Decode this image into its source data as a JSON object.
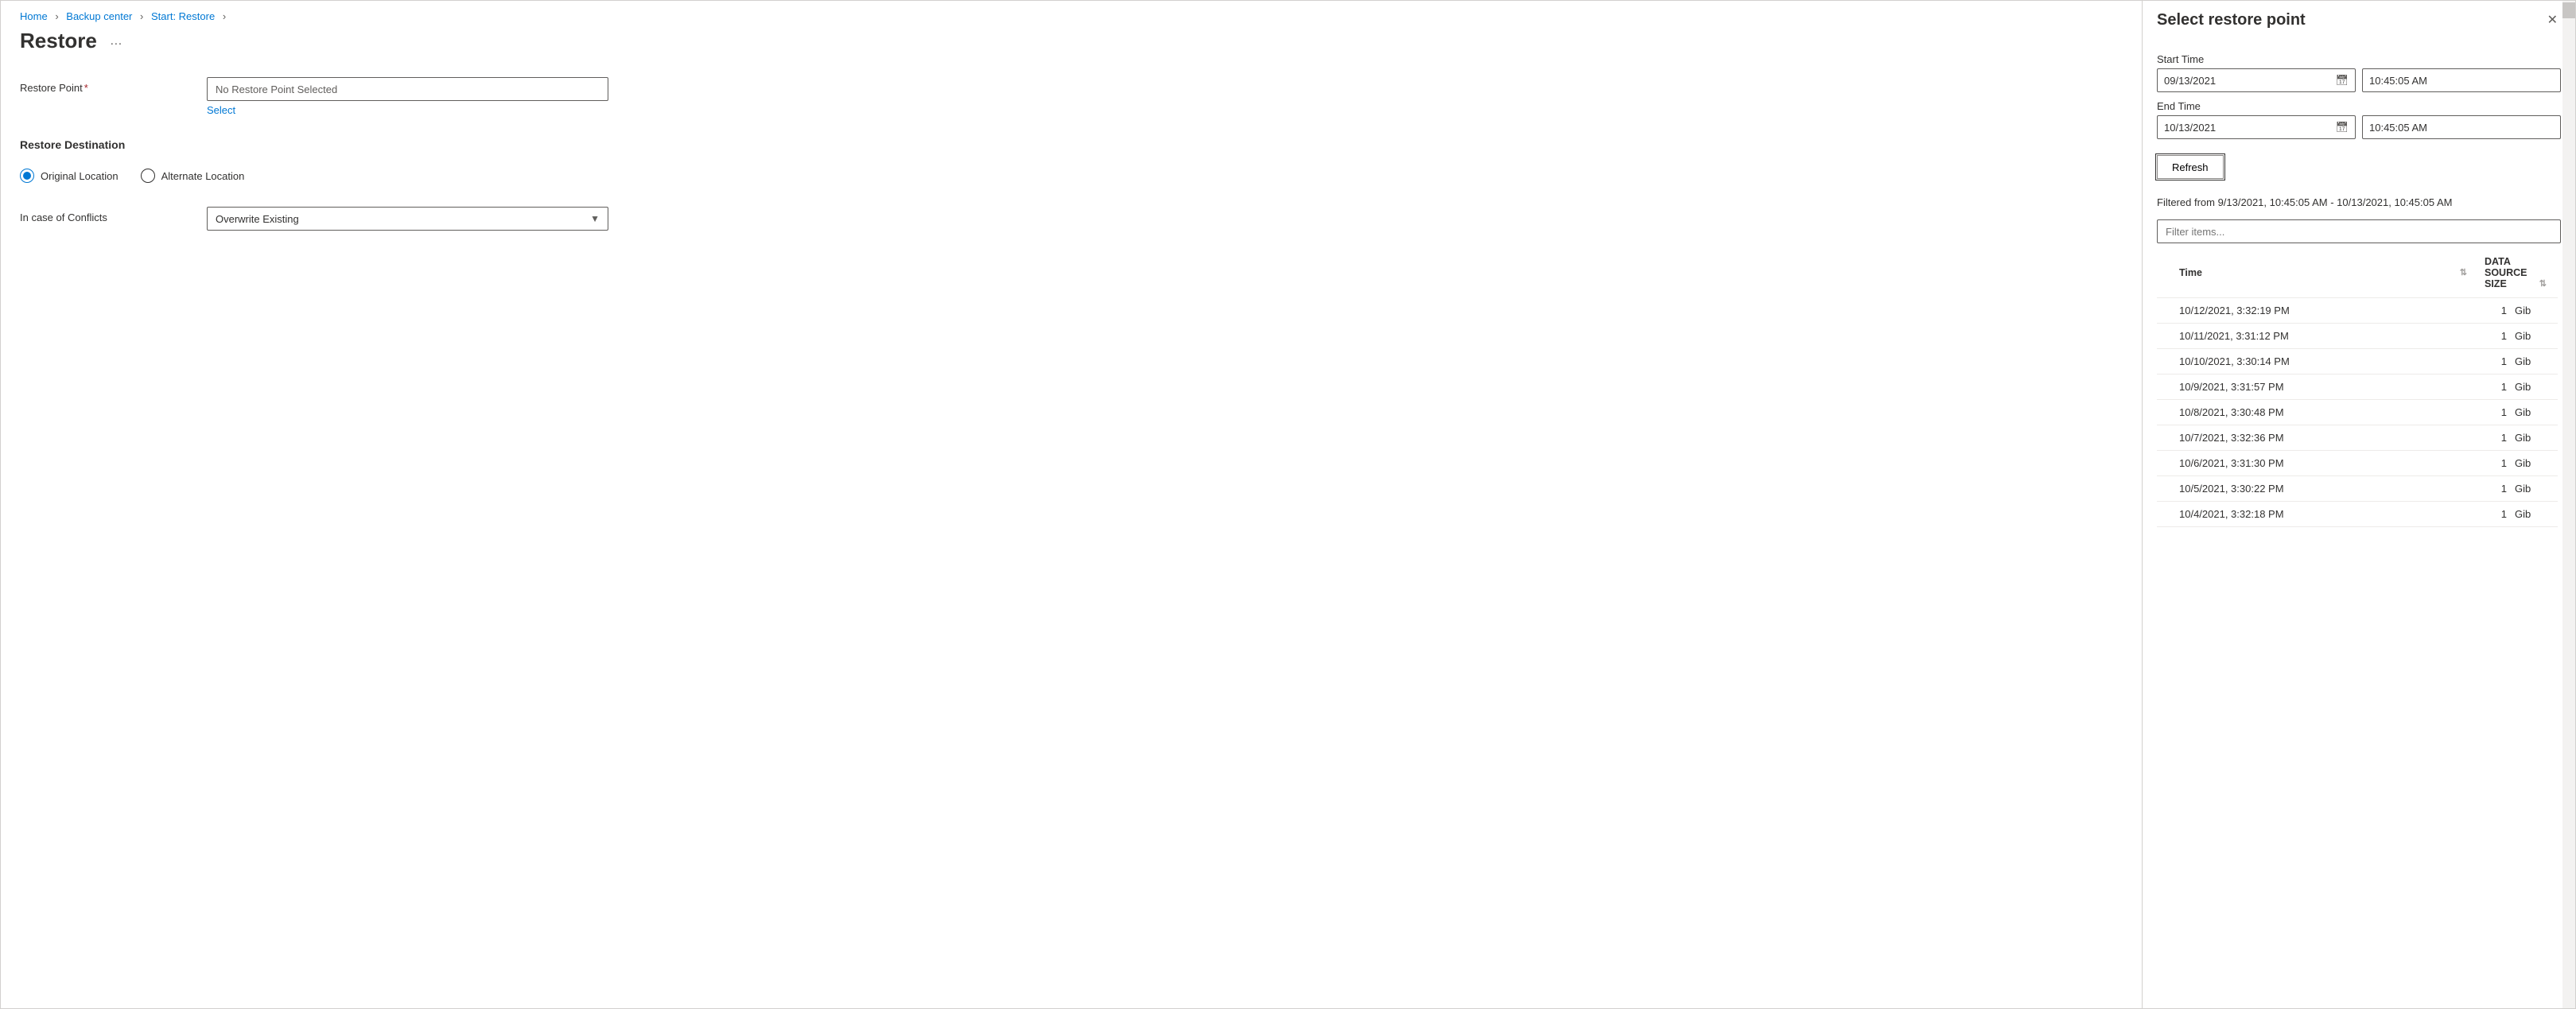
{
  "breadcrumbs": [
    {
      "label": "Home"
    },
    {
      "label": "Backup center"
    },
    {
      "label": "Start: Restore"
    }
  ],
  "page_title": "Restore",
  "restore_point": {
    "label": "Restore Point",
    "value": "No Restore Point Selected",
    "select_link": "Select"
  },
  "destination": {
    "heading": "Restore Destination",
    "options": [
      {
        "label": "Original Location",
        "selected": true
      },
      {
        "label": "Alternate Location",
        "selected": false
      }
    ]
  },
  "conflicts": {
    "label": "In case of Conflicts",
    "selected": "Overwrite Existing"
  },
  "panel": {
    "title": "Select restore point",
    "start_label": "Start Time",
    "start_date": "09/13/2021",
    "start_time": "10:45:05 AM",
    "end_label": "End Time",
    "end_date": "10/13/2021",
    "end_time": "10:45:05 AM",
    "refresh": "Refresh",
    "filter_summary": "Filtered from 9/13/2021, 10:45:05 AM - 10/13/2021, 10:45:05 AM",
    "filter_placeholder": "Filter items...",
    "columns": {
      "time": "Time",
      "size": "DATA SOURCE SIZE"
    },
    "rows": [
      {
        "time": "10/12/2021, 3:32:19 PM",
        "size_num": "1",
        "size_unit": "Gib"
      },
      {
        "time": "10/11/2021, 3:31:12 PM",
        "size_num": "1",
        "size_unit": "Gib"
      },
      {
        "time": "10/10/2021, 3:30:14 PM",
        "size_num": "1",
        "size_unit": "Gib"
      },
      {
        "time": "10/9/2021, 3:31:57 PM",
        "size_num": "1",
        "size_unit": "Gib"
      },
      {
        "time": "10/8/2021, 3:30:48 PM",
        "size_num": "1",
        "size_unit": "Gib"
      },
      {
        "time": "10/7/2021, 3:32:36 PM",
        "size_num": "1",
        "size_unit": "Gib"
      },
      {
        "time": "10/6/2021, 3:31:30 PM",
        "size_num": "1",
        "size_unit": "Gib"
      },
      {
        "time": "10/5/2021, 3:30:22 PM",
        "size_num": "1",
        "size_unit": "Gib"
      },
      {
        "time": "10/4/2021, 3:32:18 PM",
        "size_num": "1",
        "size_unit": "Gib"
      }
    ]
  }
}
